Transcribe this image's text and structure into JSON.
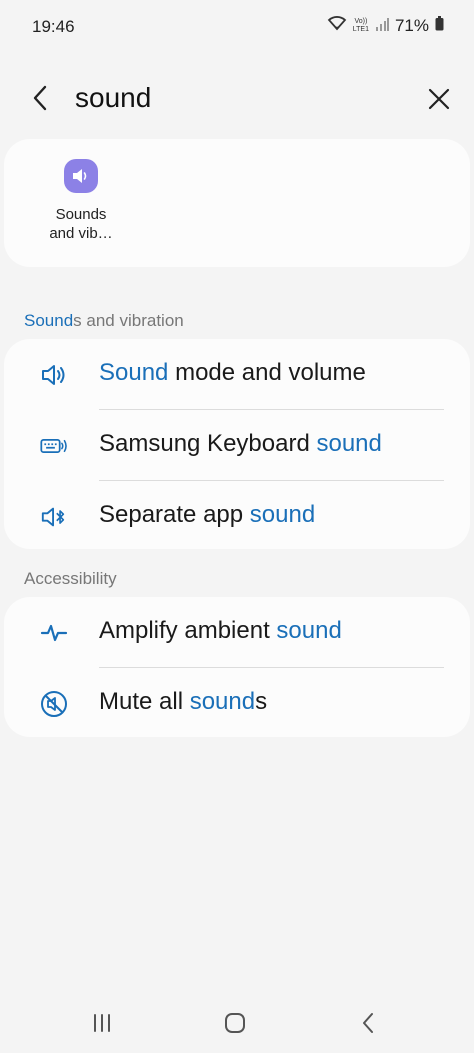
{
  "status": {
    "time": "19:46",
    "volte": "Vo))",
    "lte": "LTE1",
    "battery": "71%"
  },
  "header": {
    "query": "sound"
  },
  "top_result": {
    "app_label_line1": "Sounds",
    "app_label_line2": "and vib…"
  },
  "sections": {
    "sounds": {
      "title_hl": "Sound",
      "title_rest": "s and vibration",
      "items": [
        {
          "pre": "",
          "hl": "Sound",
          "post": " mode and volume",
          "icon": "speaker-icon"
        },
        {
          "pre": "Samsung Keyboard ",
          "hl": "sound",
          "post": "",
          "icon": "keyboard-sound-icon"
        },
        {
          "pre": "Separate app ",
          "hl": "sound",
          "post": "",
          "icon": "bluetooth-speaker-icon"
        }
      ]
    },
    "accessibility": {
      "title": "Accessibility",
      "items": [
        {
          "pre": "Amplify ambient ",
          "hl": "sound",
          "post": "",
          "icon": "waveform-icon"
        },
        {
          "pre": "Mute all ",
          "hl": "sound",
          "post": "s",
          "icon": "mute-icon"
        }
      ]
    }
  },
  "colors": {
    "highlight": "#1a6fb8",
    "app_icon_bg": "#8c81e6",
    "background": "#f4f4f4"
  }
}
